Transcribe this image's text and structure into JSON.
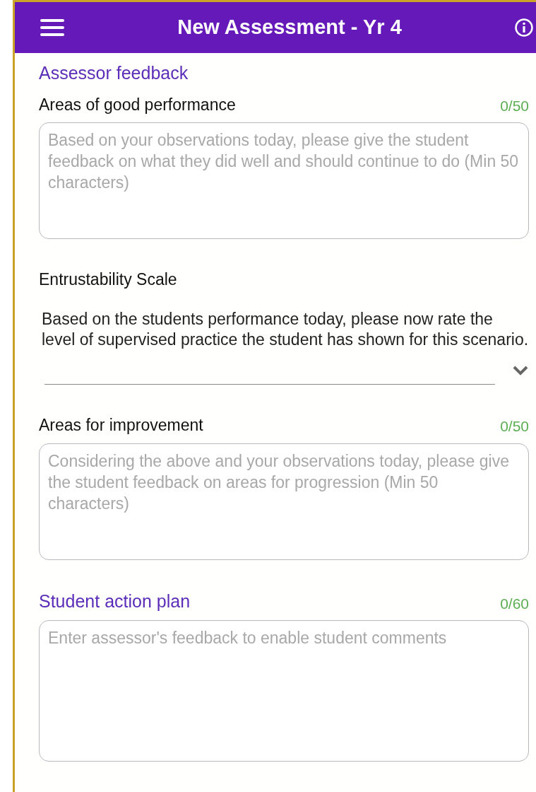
{
  "header": {
    "title": "New Assessment - Yr 4"
  },
  "sections": [
    {
      "kind": "heading",
      "label": "Assessor feedback"
    },
    {
      "kind": "textarea",
      "label": "Areas of good performance",
      "counter": "0/50",
      "placeholder": "Based on your observations today, please give the student feedback on what they did well and should continue to do (Min 50 characters)"
    },
    {
      "kind": "select",
      "label": "Entrustability Scale",
      "description": "Based on the students performance today, please now rate the level of supervised practice the student has shown for this scenario."
    },
    {
      "kind": "textarea",
      "label": "Areas for improvement",
      "counter": "0/50",
      "placeholder": "Considering the above and your observations today, please give the student feedback on areas for progression (Min 50 characters)"
    },
    {
      "kind": "textarea-heading",
      "label": "Student action plan",
      "counter": "0/60",
      "placeholder": "Enter assessor's feedback to enable student comments"
    }
  ]
}
